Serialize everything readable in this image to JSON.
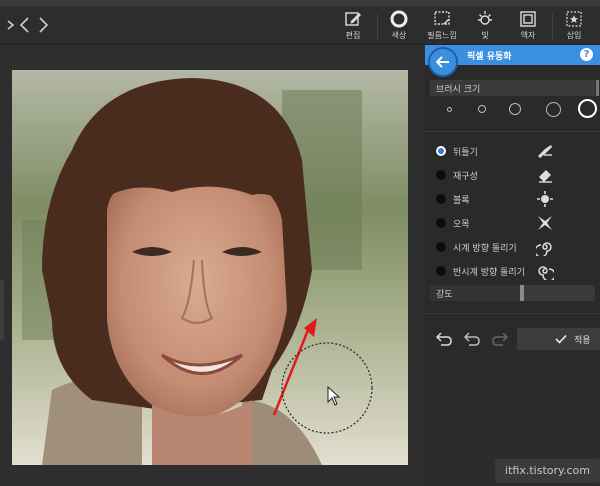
{
  "toolbar": {
    "tools": [
      {
        "label": "편집",
        "icon": "edit-icon"
      },
      {
        "label": "색상",
        "icon": "color-circle-icon"
      },
      {
        "label": "필름느낌",
        "icon": "film-frame-icon"
      },
      {
        "label": "빛",
        "icon": "sun-icon"
      },
      {
        "label": "액자",
        "icon": "frame-icon"
      },
      {
        "label": "삽입",
        "icon": "insert-star-icon"
      }
    ]
  },
  "panel": {
    "title": "픽셀 유동화",
    "help": "?",
    "brush_section_label": "브러시 크기",
    "brush_sizes": [
      "xs",
      "s",
      "m",
      "l",
      "xl"
    ],
    "selected_brush": "xl",
    "options": [
      {
        "label": "뒤틀기",
        "selected": true,
        "icon": "warp-icon"
      },
      {
        "label": "재구성",
        "selected": false,
        "icon": "eraser-icon"
      },
      {
        "label": "볼록",
        "selected": false,
        "icon": "bulge-icon"
      },
      {
        "label": "오목",
        "selected": false,
        "icon": "pinch-icon"
      },
      {
        "label": "시계 방향 돌리기",
        "selected": false,
        "icon": "clockwise-spiral-icon"
      },
      {
        "label": "반시계 방향 돌리기",
        "selected": false,
        "icon": "counterclockwise-spiral-icon"
      }
    ],
    "strength_label": "강도",
    "strength_value": 0.56,
    "apply_label": "적용"
  },
  "watermark": "itfix.tistory.com",
  "colors": {
    "accent": "#3b8fe0",
    "panel_bg": "#2a2a2a",
    "arrow": "#e11b1b"
  }
}
